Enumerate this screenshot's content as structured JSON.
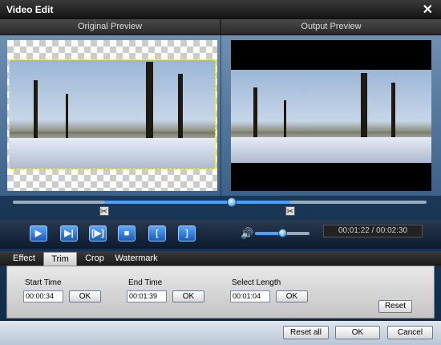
{
  "window": {
    "title": "Video Edit",
    "close_icon": "close-icon"
  },
  "preview": {
    "original_heading": "Original Preview",
    "output_heading": "Output Preview"
  },
  "seek": {
    "position_fraction": 0.53,
    "trim_start_fraction": 0.22,
    "trim_end_fraction": 0.67
  },
  "playback": {
    "buttons": [
      {
        "name": "play-button",
        "icon": "play-icon",
        "glyph": "▶"
      },
      {
        "name": "next-frame-button",
        "icon": "step-forward-icon",
        "glyph": "▶|"
      },
      {
        "name": "snapshot-button",
        "icon": "frame-icon",
        "glyph": "[▶]"
      },
      {
        "name": "stop-button",
        "icon": "stop-icon",
        "glyph": "■"
      },
      {
        "name": "mark-in-button",
        "icon": "bracket-left-icon",
        "glyph": "["
      },
      {
        "name": "mark-out-button",
        "icon": "bracket-right-icon",
        "glyph": "]"
      }
    ],
    "volume_fraction": 0.5,
    "time_display": "00:01:22 / 00:02:30"
  },
  "tabs": [
    {
      "label": "Effect",
      "active": false
    },
    {
      "label": "Trim",
      "active": true
    },
    {
      "label": "Crop",
      "active": false
    },
    {
      "label": "Watermark",
      "active": false
    }
  ],
  "trim": {
    "start_label": "Start Time",
    "start_value": "00:00:34",
    "end_label": "End Time",
    "end_value": "00:01:39",
    "length_label": "Select Length",
    "length_value": "00:01:04",
    "ok_label": "OK",
    "reset_label": "Reset"
  },
  "footer": {
    "reset_all_label": "Reset all",
    "ok_label": "OK",
    "cancel_label": "Cancel"
  },
  "colors": {
    "accent": "#2a7fd0",
    "background": "#0e2a48"
  }
}
